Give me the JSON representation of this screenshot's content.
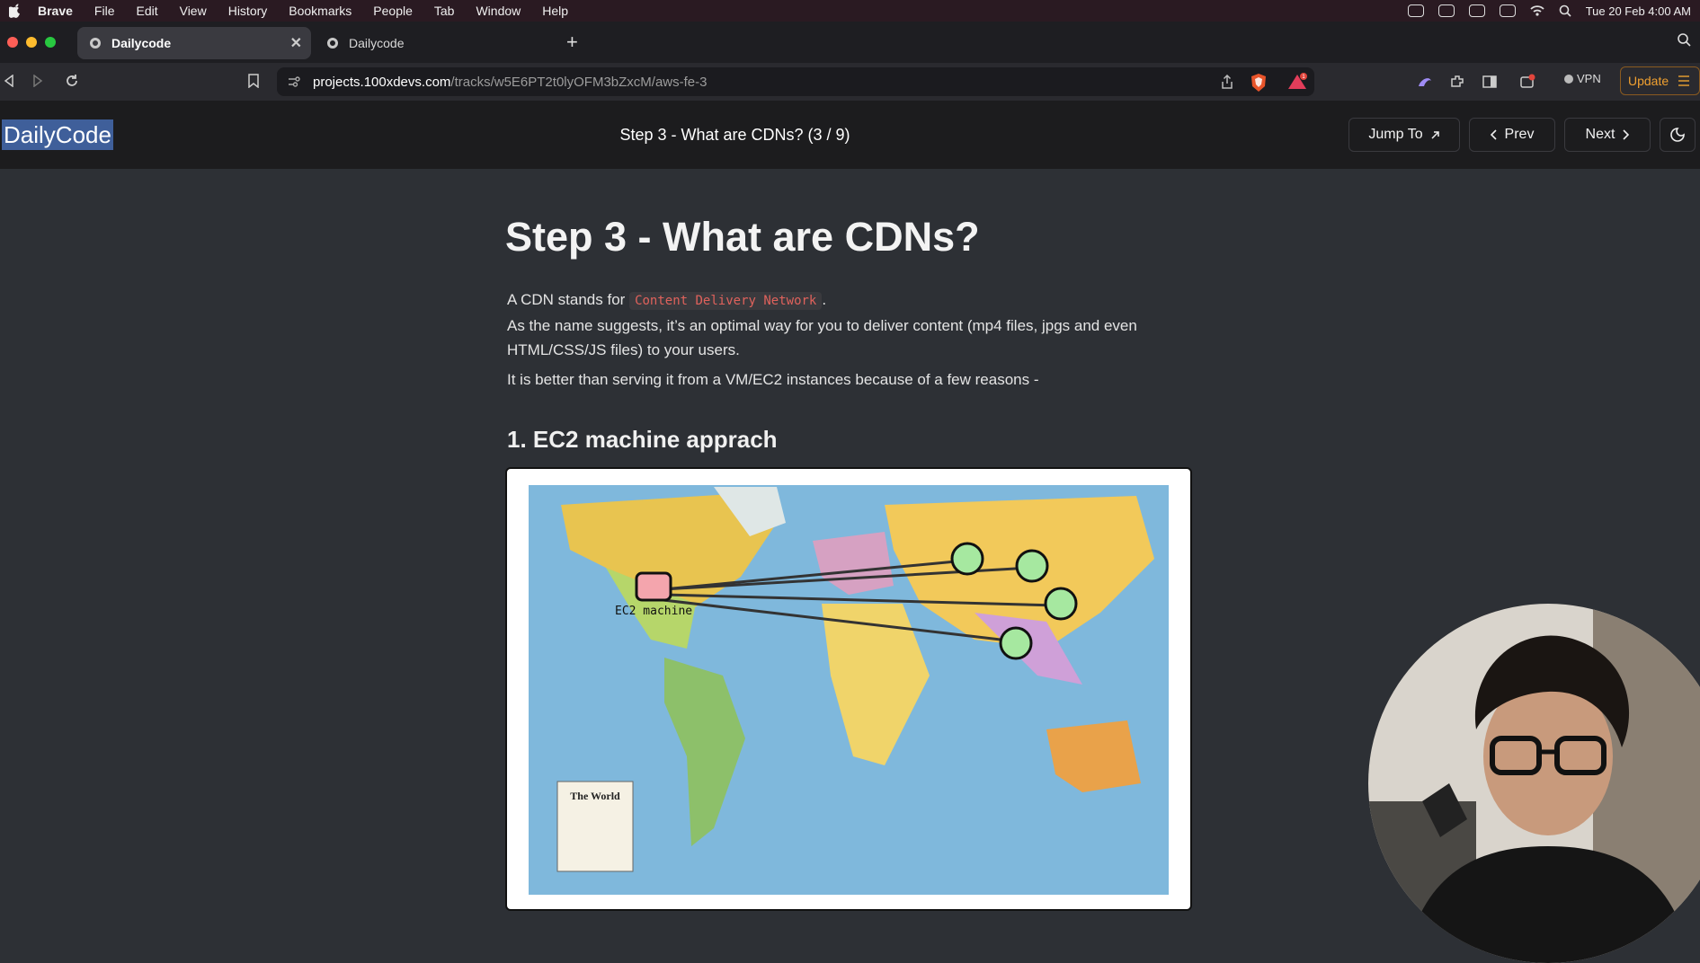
{
  "menubar": {
    "app_name": "Brave",
    "items": [
      "File",
      "Edit",
      "View",
      "History",
      "Bookmarks",
      "People",
      "Tab",
      "Window",
      "Help"
    ],
    "clock": "Tue 20 Feb  4:00 AM"
  },
  "tabs": [
    {
      "label": "Dailycode",
      "active": true
    },
    {
      "label": "Dailycode",
      "active": false
    }
  ],
  "address": {
    "domain": "projects.100xdevs.com",
    "path": "/tracks/w5E6PT2t0lyOFM3bZxcM/aws-fe-3"
  },
  "toolbar": {
    "vpn_label": "VPN",
    "update_label": "Update",
    "rewards_badge": "1"
  },
  "site": {
    "logo": "DailyCode",
    "step_title": "Step 3 - What are CDNs? (3 / 9)",
    "jump_label": "Jump To",
    "prev_label": "Prev",
    "next_label": "Next"
  },
  "article": {
    "heading": "Step 3 - What are CDNs?",
    "intro_prefix": "A CDN stands for",
    "intro_code": "Content Delivery Network",
    "intro_suffix": ".",
    "para1": "As the name suggests, it’s an optimal way for you to deliver content (mp4 files, jpgs and even HTML/CSS/JS files) to your users.",
    "para2": "It is better than serving it from a VM/EC2 instances because of a few reasons -",
    "subheading": "1. EC2 machine apprach",
    "diagram": {
      "machine_label": "EC2 machine",
      "inset_title": "The World"
    }
  },
  "colors": {
    "page_bg": "#2d3035",
    "header_bg": "#1c1c1e",
    "code_text": "#e0625c",
    "ec2_box": "#f4a5ad",
    "user_node": "#a6e8a0",
    "ocean": "#7fb8dc"
  }
}
